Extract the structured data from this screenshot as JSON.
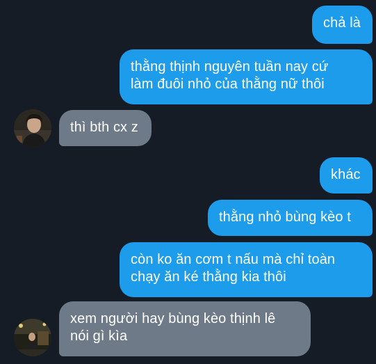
{
  "messages": [
    {
      "id": "m1",
      "direction": "outgoing",
      "text": "chả là"
    },
    {
      "id": "m2",
      "direction": "outgoing",
      "text": "thằng thịnh nguyên tuần nay cứ\nlàm đuôi nhỏ của thằng nữ thôi"
    },
    {
      "id": "m3",
      "direction": "incoming",
      "text": "thì bth cx z"
    },
    {
      "id": "m4",
      "direction": "outgoing",
      "text": "khác"
    },
    {
      "id": "m5",
      "direction": "outgoing",
      "text": "thằng nhỏ bùng kèo t"
    },
    {
      "id": "m6",
      "direction": "outgoing",
      "text": "còn ko ăn cơm t nấu mà chỉ toàn\nchạy ăn ké thằng kia thôi"
    },
    {
      "id": "m7",
      "direction": "incoming",
      "text": "xem người hay bùng kèo thịnh lê\nnói gì kìa"
    }
  ],
  "colors": {
    "background": "#161c26",
    "outgoing_bubble": "#1d9ceb",
    "incoming_bubble": "#6e7a87",
    "text": "#ffffff"
  }
}
